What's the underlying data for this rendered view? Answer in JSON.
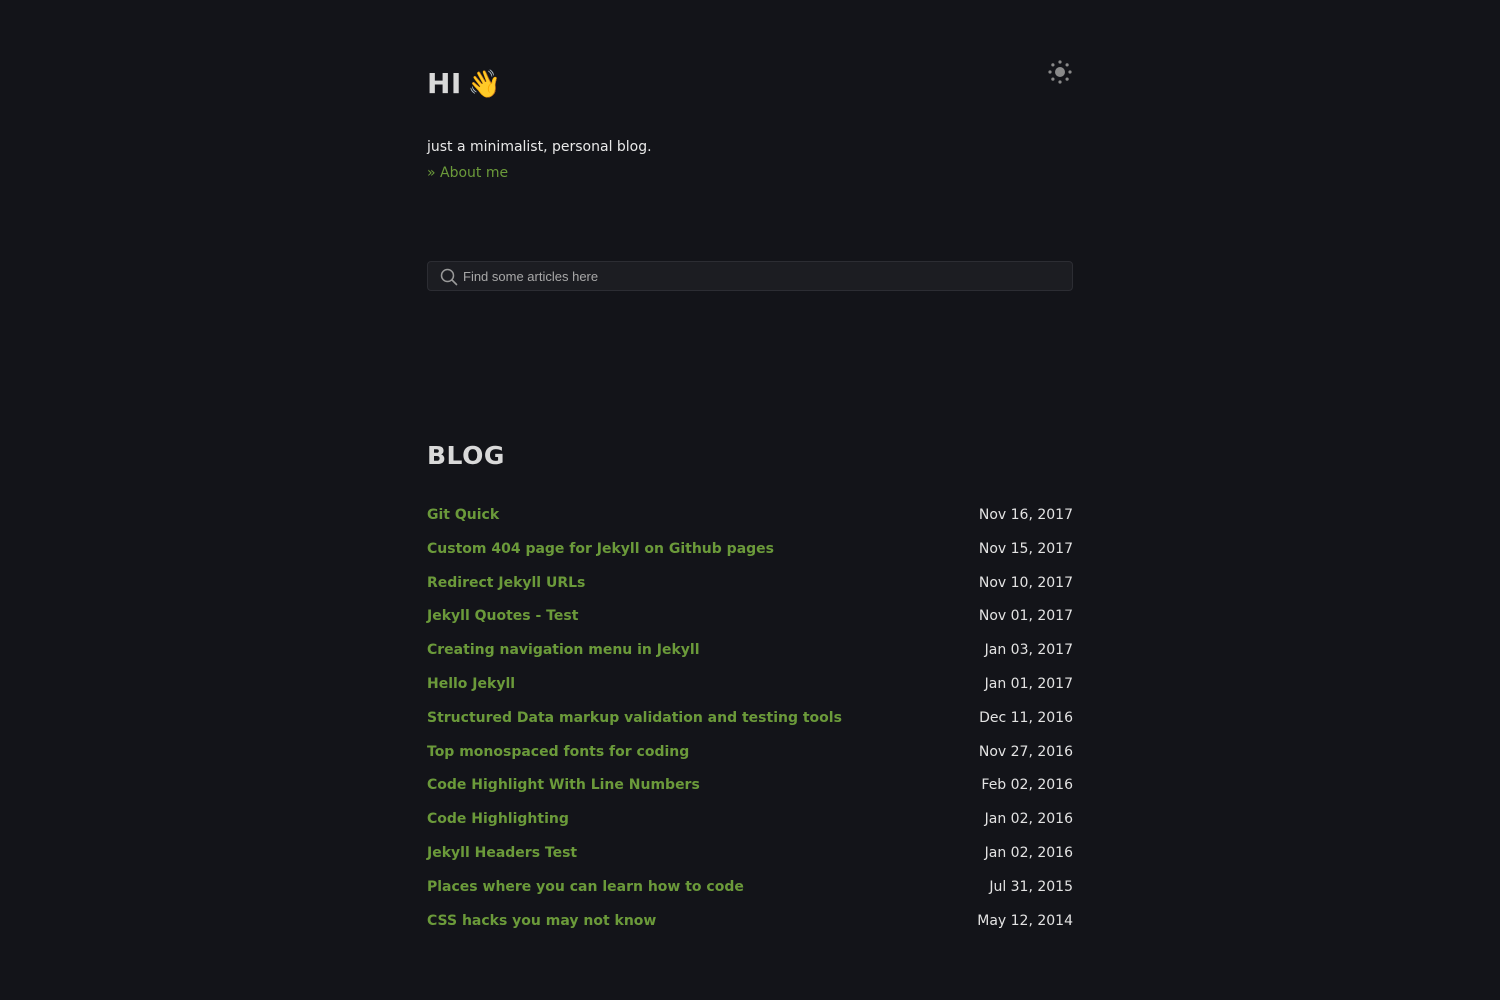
{
  "header": {
    "greeting": "HI",
    "greeting_emoji": "👋",
    "tagline": "just a minimalist, personal blog.",
    "about_link": "» About me",
    "theme_toggle_icon": "sun-icon"
  },
  "search": {
    "placeholder": "Find some articles here",
    "icon": "search-icon"
  },
  "blog": {
    "heading": "BLOG",
    "posts": [
      {
        "title": "Git Quick",
        "date": "Nov 16, 2017"
      },
      {
        "title": "Custom 404 page for Jekyll on Github pages",
        "date": "Nov 15, 2017"
      },
      {
        "title": "Redirect Jekyll URLs",
        "date": "Nov 10, 2017"
      },
      {
        "title": "Jekyll Quotes - Test",
        "date": "Nov 01, 2017"
      },
      {
        "title": "Creating navigation menu in Jekyll",
        "date": "Jan 03, 2017"
      },
      {
        "title": "Hello Jekyll",
        "date": "Jan 01, 2017"
      },
      {
        "title": "Structured Data markup validation and testing tools",
        "date": "Dec 11, 2016"
      },
      {
        "title": "Top monospaced fonts for coding",
        "date": "Nov 27, 2016"
      },
      {
        "title": "Code Highlight With Line Numbers",
        "date": "Feb 02, 2016"
      },
      {
        "title": "Code Highlighting",
        "date": "Jan 02, 2016"
      },
      {
        "title": "Jekyll Headers Test",
        "date": "Jan 02, 2016"
      },
      {
        "title": "Places where you can learn how to code",
        "date": "Jul 31, 2015"
      },
      {
        "title": "CSS hacks you may not know",
        "date": "May 12, 2014"
      }
    ]
  },
  "colors": {
    "background": "#131419",
    "link": "#6b9a3a",
    "text": "#e6e6e6",
    "heading": "#d9d9d9"
  }
}
